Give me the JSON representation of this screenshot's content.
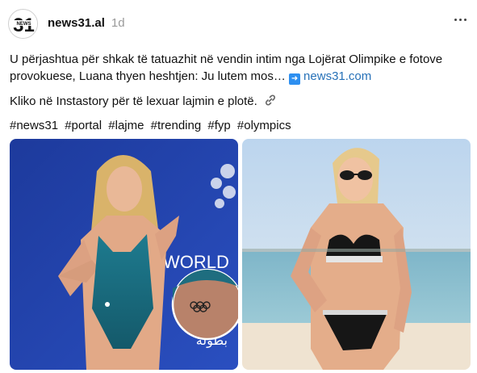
{
  "post": {
    "avatar_logo": "31",
    "avatar_logo_small": "NEWS",
    "handle": "news31.al",
    "time": "1d",
    "caption_text": "U përjashtua për shkak të tatuazhit në vendin intim nga Lojërat Olimpike e fotove provokuese, Luana thyen heshtjen: Ju lutem mos…",
    "caption_link": "news31.com",
    "line2": "Kliko në Instastory për të lexuar lajmin e plotë.",
    "hashtags": [
      "#news31",
      "#portal",
      "#lajme",
      "#trending",
      "#fyp",
      "#olympics"
    ]
  },
  "images": {
    "left_banner_text": "WORLD",
    "left_banner_arabic": "بطولة"
  },
  "colors": {
    "link": "#2671b8",
    "arrow_badge": "#2d8ff0",
    "handle": "#111111",
    "time": "#9a9a9a"
  },
  "icons": [
    "more-options-icon",
    "arrow-right-icon",
    "link-icon"
  ]
}
